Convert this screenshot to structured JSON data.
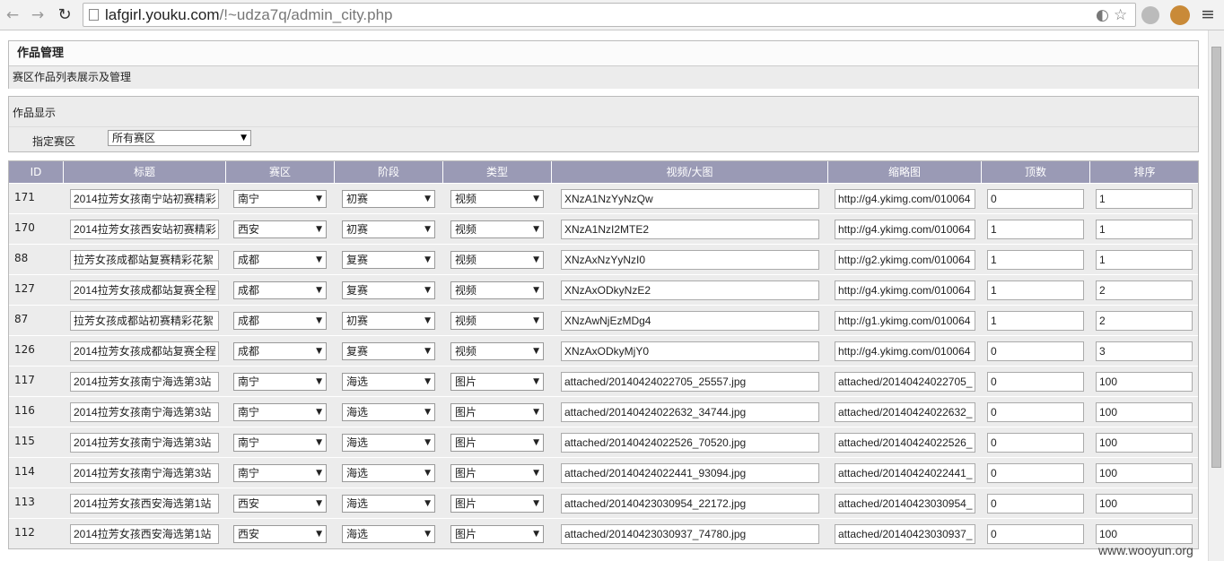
{
  "browser": {
    "url_host": "lafgirl.youku.com",
    "url_path": "/!~udza7q/admin_city.php"
  },
  "panel": {
    "title": "作品管理",
    "subtitle": "赛区作品列表展示及管理"
  },
  "filter": {
    "section_title": "作品显示",
    "region_label": "指定赛区",
    "region_value": "所有赛区"
  },
  "table": {
    "columns": [
      "ID",
      "标题",
      "赛区",
      "阶段",
      "类型",
      "视频/大图",
      "缩略图",
      "顶数",
      "排序"
    ],
    "rows": [
      {
        "id": "171",
        "title": "2014拉芳女孩南宁站初赛精彩",
        "region": "南宁",
        "stage": "初赛",
        "type": "视频",
        "media": "XNzA1NzYyNzQw",
        "thumb": "http://g4.ykimg.com/010064",
        "votes": "0",
        "order": "1"
      },
      {
        "id": "170",
        "title": "2014拉芳女孩西安站初赛精彩",
        "region": "西安",
        "stage": "初赛",
        "type": "视频",
        "media": "XNzA1NzI2MTE2",
        "thumb": "http://g4.ykimg.com/010064",
        "votes": "1",
        "order": "1"
      },
      {
        "id": "88",
        "title": "拉芳女孩成都站复赛精彩花絮",
        "region": "成都",
        "stage": "复赛",
        "type": "视频",
        "media": "XNzAxNzYyNzI0",
        "thumb": "http://g2.ykimg.com/010064",
        "votes": "1",
        "order": "1"
      },
      {
        "id": "127",
        "title": "2014拉芳女孩成都站复赛全程",
        "region": "成都",
        "stage": "复赛",
        "type": "视频",
        "media": "XNzAxODkyNzE2",
        "thumb": "http://g4.ykimg.com/010064",
        "votes": "1",
        "order": "2"
      },
      {
        "id": "87",
        "title": "拉芳女孩成都站初赛精彩花絮",
        "region": "成都",
        "stage": "初赛",
        "type": "视频",
        "media": "XNzAwNjEzMDg4",
        "thumb": "http://g1.ykimg.com/010064",
        "votes": "1",
        "order": "2"
      },
      {
        "id": "126",
        "title": "2014拉芳女孩成都站复赛全程",
        "region": "成都",
        "stage": "复赛",
        "type": "视频",
        "media": "XNzAxODkyMjY0",
        "thumb": "http://g4.ykimg.com/010064",
        "votes": "0",
        "order": "3"
      },
      {
        "id": "117",
        "title": "2014拉芳女孩南宁海选第3站",
        "region": "南宁",
        "stage": "海选",
        "type": "图片",
        "media": "attached/20140424022705_25557.jpg",
        "thumb": "attached/20140424022705_",
        "votes": "0",
        "order": "100"
      },
      {
        "id": "116",
        "title": "2014拉芳女孩南宁海选第3站",
        "region": "南宁",
        "stage": "海选",
        "type": "图片",
        "media": "attached/20140424022632_34744.jpg",
        "thumb": "attached/20140424022632_",
        "votes": "0",
        "order": "100"
      },
      {
        "id": "115",
        "title": "2014拉芳女孩南宁海选第3站",
        "region": "南宁",
        "stage": "海选",
        "type": "图片",
        "media": "attached/20140424022526_70520.jpg",
        "thumb": "attached/20140424022526_",
        "votes": "0",
        "order": "100"
      },
      {
        "id": "114",
        "title": "2014拉芳女孩南宁海选第3站",
        "region": "南宁",
        "stage": "海选",
        "type": "图片",
        "media": "attached/20140424022441_93094.jpg",
        "thumb": "attached/20140424022441_",
        "votes": "0",
        "order": "100"
      },
      {
        "id": "113",
        "title": "2014拉芳女孩西安海选第1站",
        "region": "西安",
        "stage": "海选",
        "type": "图片",
        "media": "attached/20140423030954_22172.jpg",
        "thumb": "attached/20140423030954_",
        "votes": "0",
        "order": "100"
      },
      {
        "id": "112",
        "title": "2014拉芳女孩西安海选第1站",
        "region": "西安",
        "stage": "海选",
        "type": "图片",
        "media": "attached/20140423030937_74780.jpg",
        "thumb": "attached/20140423030937_",
        "votes": "0",
        "order": "100"
      }
    ]
  },
  "watermark": "www.wooyun.org"
}
